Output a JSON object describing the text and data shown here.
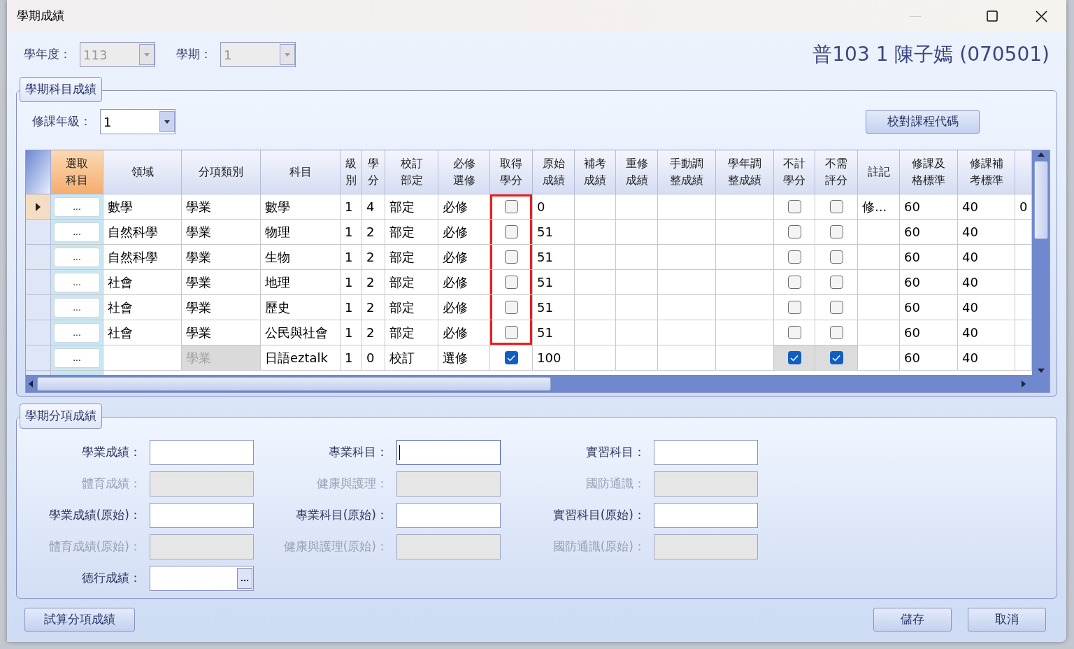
{
  "window": {
    "title": "學期成績"
  },
  "filters": [
    {
      "label": "學年度：",
      "value": "113",
      "disabled": true
    },
    {
      "label": "學期：",
      "value": "1",
      "disabled": true
    }
  ],
  "student_title": "普103 1 陳子嫣 (070501)",
  "subject_group": {
    "title": "學期科目成績",
    "grade_label": "修課年級：",
    "grade_value": "1",
    "verify_button": "校對課程代碼",
    "columns": [
      {
        "label": "選取科目",
        "selected": true
      },
      {
        "label": "領域",
        "selected": false
      },
      {
        "label": "分項類別",
        "selected": false
      },
      {
        "label": "科目",
        "selected": false
      },
      {
        "label": "級別",
        "selected": false
      },
      {
        "label": "學分",
        "selected": false
      },
      {
        "label": "校訂部定",
        "selected": false
      },
      {
        "label": "必修選修",
        "selected": false
      },
      {
        "label": "取得學分",
        "selected": false
      },
      {
        "label": "原始成績",
        "selected": false
      },
      {
        "label": "補考成績",
        "selected": false
      },
      {
        "label": "重修成績",
        "selected": false
      },
      {
        "label": "手動調整成績",
        "selected": false
      },
      {
        "label": "學年調整成績",
        "selected": false
      },
      {
        "label": "不計學分",
        "selected": false
      },
      {
        "label": "不需評分",
        "selected": false
      },
      {
        "label": "註記",
        "selected": false
      },
      {
        "label": "修課及格標準",
        "selected": false
      },
      {
        "label": "修課補考標準",
        "selected": false
      },
      {
        "selected": false
      }
    ],
    "rows": [
      {
        "selected": true,
        "cells": [
          {
            "kind": "button",
            "text": "..."
          },
          "數學",
          "學業",
          "數學",
          "1",
          "4",
          "部定",
          "必修",
          {
            "kind": "check",
            "checked": false,
            "highlighted": true
          },
          "0",
          null,
          null,
          null,
          null,
          {
            "kind": "check",
            "checked": false
          },
          {
            "kind": "check",
            "checked": false
          },
          "修...",
          "60",
          "40",
          "0"
        ]
      },
      {
        "selected": false,
        "cells": [
          {
            "kind": "button",
            "text": "..."
          },
          "自然科學",
          "學業",
          "物理",
          "1",
          "2",
          "部定",
          "必修",
          {
            "kind": "check",
            "checked": false,
            "highlighted": true
          },
          "51",
          null,
          null,
          null,
          null,
          {
            "kind": "check",
            "checked": false
          },
          {
            "kind": "check",
            "checked": false
          },
          null,
          "60",
          "40",
          null
        ]
      },
      {
        "selected": false,
        "cells": [
          {
            "kind": "button",
            "text": "..."
          },
          "自然科學",
          "學業",
          "生物",
          "1",
          "2",
          "部定",
          "必修",
          {
            "kind": "check",
            "checked": false,
            "highlighted": true
          },
          "51",
          null,
          null,
          null,
          null,
          {
            "kind": "check",
            "checked": false
          },
          {
            "kind": "check",
            "checked": false
          },
          null,
          "60",
          "40",
          null
        ]
      },
      {
        "selected": false,
        "cells": [
          {
            "kind": "button",
            "text": "..."
          },
          "社會",
          "學業",
          "地理",
          "1",
          "2",
          "部定",
          "必修",
          {
            "kind": "check",
            "checked": false,
            "highlighted": true
          },
          "51",
          null,
          null,
          null,
          null,
          {
            "kind": "check",
            "checked": false
          },
          {
            "kind": "check",
            "checked": false
          },
          null,
          "60",
          "40",
          null
        ]
      },
      {
        "selected": false,
        "cells": [
          {
            "kind": "button",
            "text": "..."
          },
          "社會",
          "學業",
          "歷史",
          "1",
          "2",
          "部定",
          "必修",
          {
            "kind": "check",
            "checked": false,
            "highlighted": true
          },
          "51",
          null,
          null,
          null,
          null,
          {
            "kind": "check",
            "checked": false
          },
          {
            "kind": "check",
            "checked": false
          },
          null,
          "60",
          "40",
          null
        ]
      },
      {
        "selected": false,
        "cells": [
          {
            "kind": "button",
            "text": "..."
          },
          "社會",
          "學業",
          "公民與社會",
          "1",
          "2",
          "部定",
          "必修",
          {
            "kind": "check",
            "checked": false,
            "highlighted": true
          },
          "51",
          null,
          null,
          null,
          null,
          {
            "kind": "check",
            "checked": false
          },
          {
            "kind": "check",
            "checked": false
          },
          null,
          "60",
          "40",
          null
        ]
      },
      {
        "selected": false,
        "cells": [
          {
            "kind": "button",
            "text": "..."
          },
          null,
          {
            "kind": "text",
            "text": "學業",
            "disabled": true
          },
          "日語eztalk",
          "1",
          "0",
          "校訂",
          "選修",
          {
            "kind": "check",
            "checked": true,
            "highlighted": false
          },
          "100",
          null,
          null,
          null,
          null,
          {
            "kind": "check",
            "checked": true,
            "disabled": true
          },
          {
            "kind": "check",
            "checked": true,
            "disabled": true
          },
          null,
          "60",
          "40",
          null
        ]
      }
    ]
  },
  "category_group": {
    "title": "學期分項成績",
    "fields": [
      {
        "label": "學業成績：",
        "disabled": false,
        "focused": false
      },
      {
        "label": "專業科目：",
        "disabled": false,
        "focused": true
      },
      {
        "label": "實習科目：",
        "disabled": false,
        "focused": false
      },
      {
        "label": "體育成績：",
        "disabled": true,
        "focused": false
      },
      {
        "label": "健康與護理：",
        "disabled": true,
        "focused": false
      },
      {
        "label": "國防通識：",
        "disabled": true,
        "focused": false
      },
      {
        "label": "學業成績(原始)：",
        "disabled": false,
        "focused": false
      },
      {
        "label": "專業科目(原始)：",
        "disabled": false,
        "focused": false
      },
      {
        "label": "實習科目(原始)：",
        "disabled": false,
        "focused": false
      },
      {
        "label": "體育成績(原始)：",
        "disabled": true,
        "focused": false
      },
      {
        "label": "健康與護理(原始)：",
        "disabled": true,
        "focused": false
      },
      {
        "label": "國防通識(原始)：",
        "disabled": true,
        "focused": false
      },
      {
        "label": "德行成績：",
        "disabled": false,
        "focused": false,
        "button": "..."
      }
    ]
  },
  "buttons": {
    "calculate": "試算分項成績",
    "save": "儲存",
    "cancel": "取消"
  }
}
